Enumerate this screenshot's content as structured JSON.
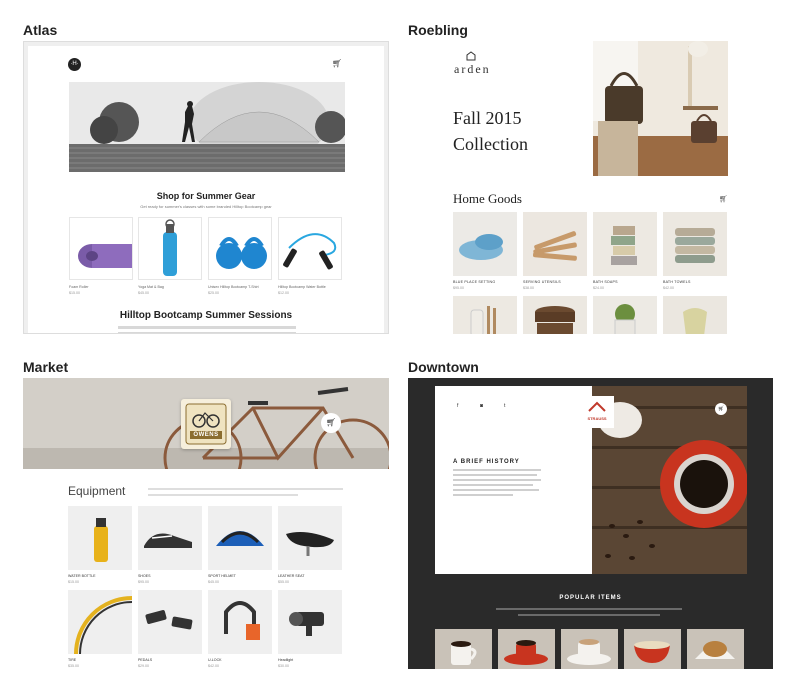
{
  "themes": {
    "atlas": {
      "name": "Atlas",
      "logo_text": "·H·",
      "hero_heading": "Shop for Summer Gear",
      "hero_sub": "Get ready for summer's classes with some branded Hilltop Bootcamp gear",
      "products": [
        {
          "label": "Foam Roller",
          "price": "$15.00"
        },
        {
          "label": "Yoga Mat & Bag",
          "price": "$45.00"
        },
        {
          "label": "Unisex Hilltop Bootcamp T-Shirt",
          "price": "$25.00"
        },
        {
          "label": "Hilltop Bootcamp Water Bottle",
          "price": "$12.00"
        }
      ],
      "section_heading": "Hilltop Bootcamp Summer Sessions"
    },
    "roebling": {
      "name": "Roebling",
      "logo": "arden",
      "collection_line1": "Fall 2015",
      "collection_line2": "Collection",
      "section": "Home Goods",
      "products": [
        {
          "label": "BLUE PLACE SETTING",
          "price": "$95.00"
        },
        {
          "label": "SERVING UTENSILS",
          "price": "$38.00"
        },
        {
          "label": "BATH SOAPS",
          "price": "$24.00"
        },
        {
          "label": "BATH TOWELS",
          "price": "$42.00"
        }
      ]
    },
    "market": {
      "name": "Market",
      "badge_text": "OWENS",
      "section": "Equipment",
      "row1": [
        {
          "label": "WATER BOTTLE",
          "price": "$15.00"
        },
        {
          "label": "SHOES",
          "price": "$95.00"
        },
        {
          "label": "SPORT HELMET",
          "price": "$45.00"
        },
        {
          "label": "LEATHER SEAT",
          "price": "$55.00"
        }
      ],
      "row2": [
        {
          "label": "TIRE",
          "price": "$35.00"
        },
        {
          "label": "PEDALS",
          "price": "$29.00"
        },
        {
          "label": "U-LOCK",
          "price": "$42.00"
        },
        {
          "label": "Headlight",
          "price": "$30.00"
        }
      ]
    },
    "downtown": {
      "name": "Downtown",
      "logo_text": "STRAUSS",
      "history_heading": "A BRIEF HISTORY",
      "popular_heading": "POPULAR ITEMS",
      "social": [
        "f",
        "◙",
        "t"
      ]
    }
  },
  "colors": {
    "roebling_accent": "#c9a06a",
    "downtown_bg": "#2a2a2a",
    "downtown_logo": "#c0392b",
    "market_frame": "#8b5a3c"
  }
}
